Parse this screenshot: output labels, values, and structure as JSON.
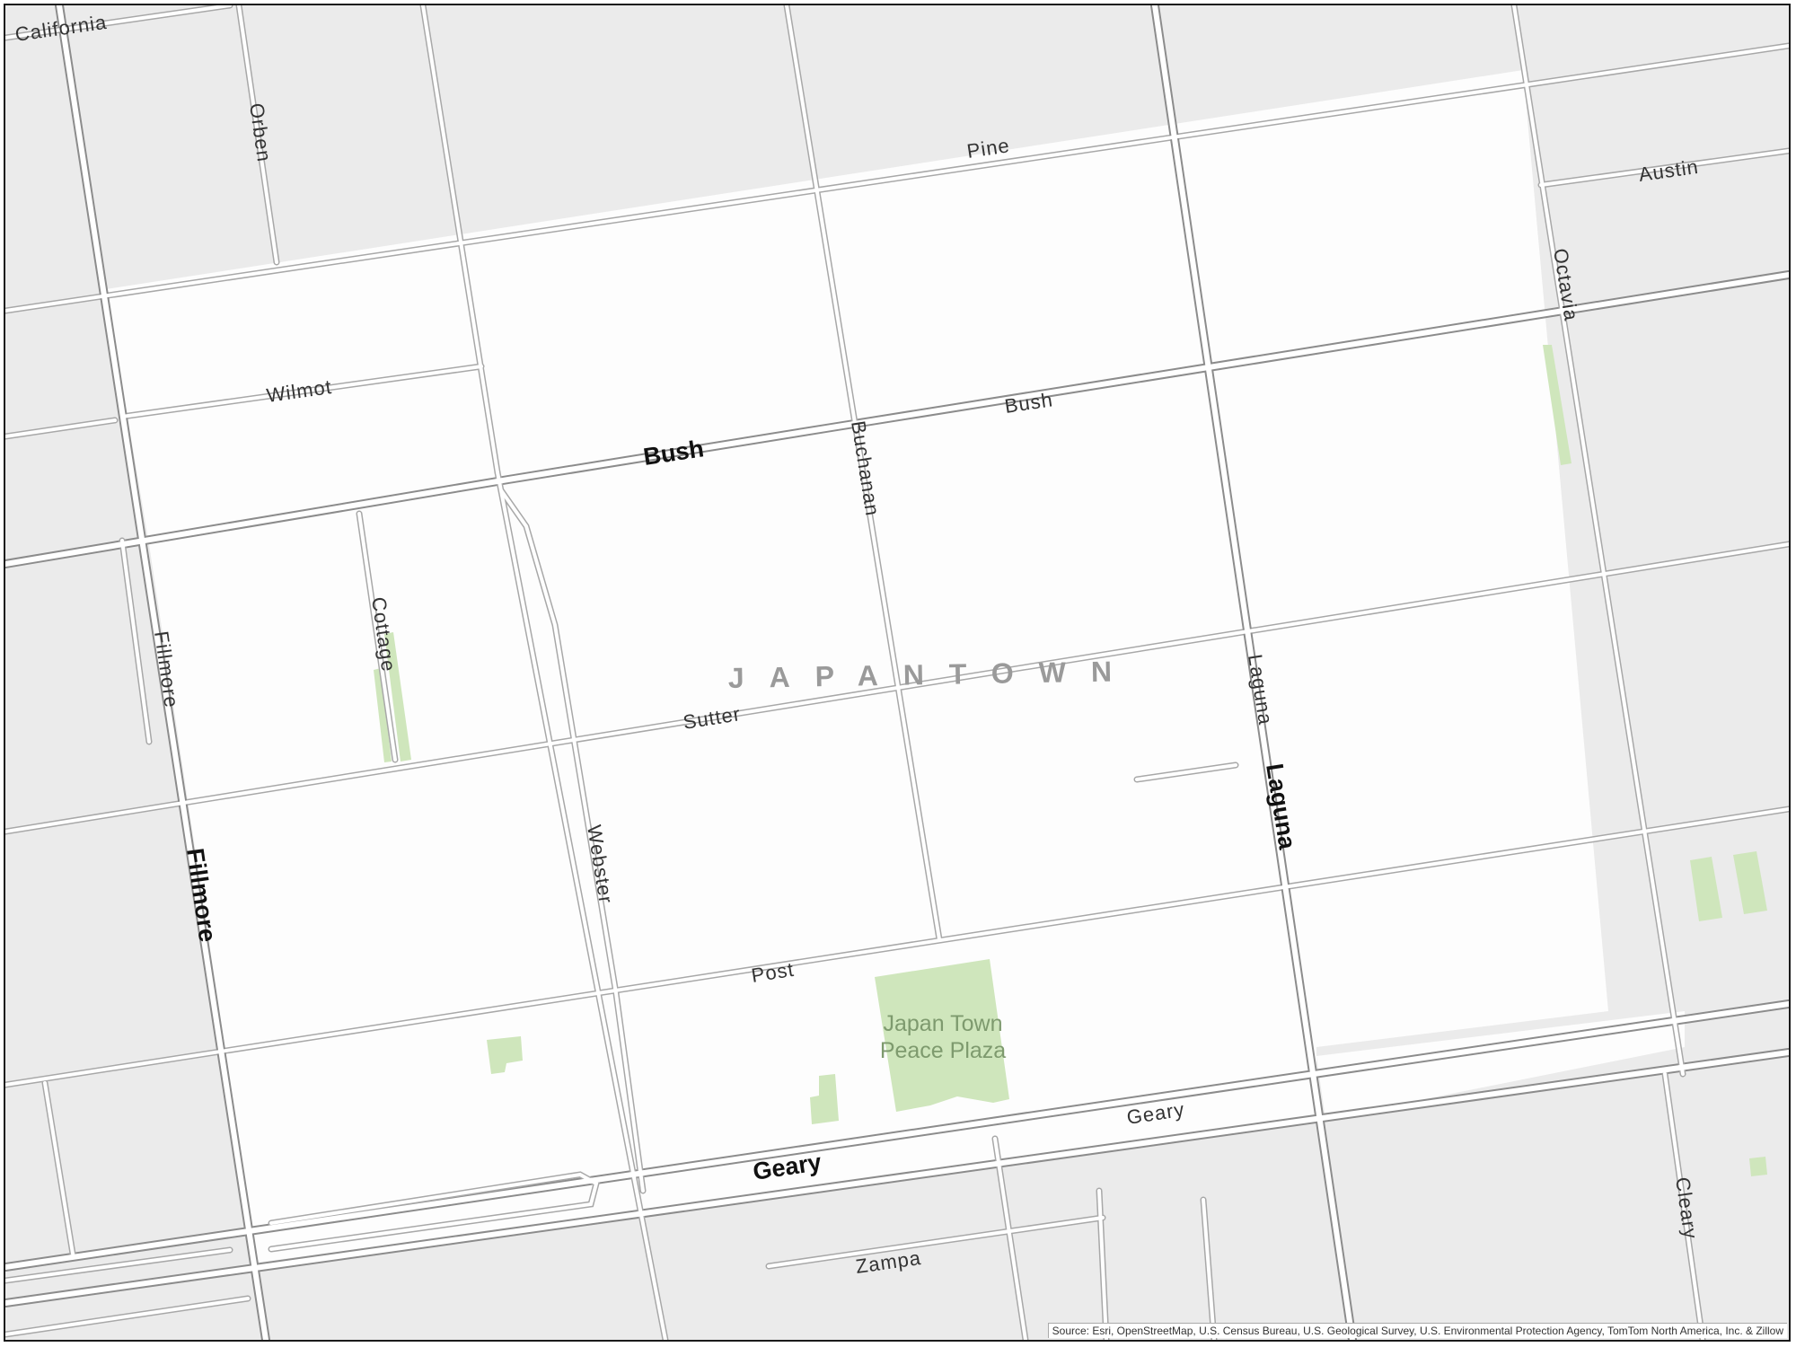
{
  "map": {
    "district_label": "JAPANTOWN",
    "park_label_line1": "Japan Town",
    "park_label_line2": "Peace Plaza",
    "streets": {
      "california": "California",
      "orben": "Orben",
      "pine": "Pine",
      "austin": "Austin",
      "octavia_north": "Octavia",
      "wilmot": "Wilmot",
      "bush_major": "Bush",
      "bush_minor": "Bush",
      "buchanan": "Buchanan",
      "cottage": "Cottage",
      "fillmore_minor": "Fillmore",
      "sutter": "Sutter",
      "laguna_minor": "Laguna",
      "laguna_major": "Laguna",
      "webster": "Webster",
      "fillmore_major": "Fillmore",
      "post": "Post",
      "geary_minor": "Geary",
      "geary_major": "Geary",
      "zampa": "Zampa",
      "cleary": "Cleary"
    },
    "colors": {
      "background_block": "#ebebeb",
      "district_fill": "#fdfdfd",
      "park_green": "#cfe6bc",
      "road_casing": "#a8a8a8"
    }
  },
  "attribution": "Source: Esri, OpenStreetMap, U.S. Census Bureau, U.S. Geological Survey, U.S. Environmental Protection Agency, TomTom North America, Inc. & Zillow"
}
